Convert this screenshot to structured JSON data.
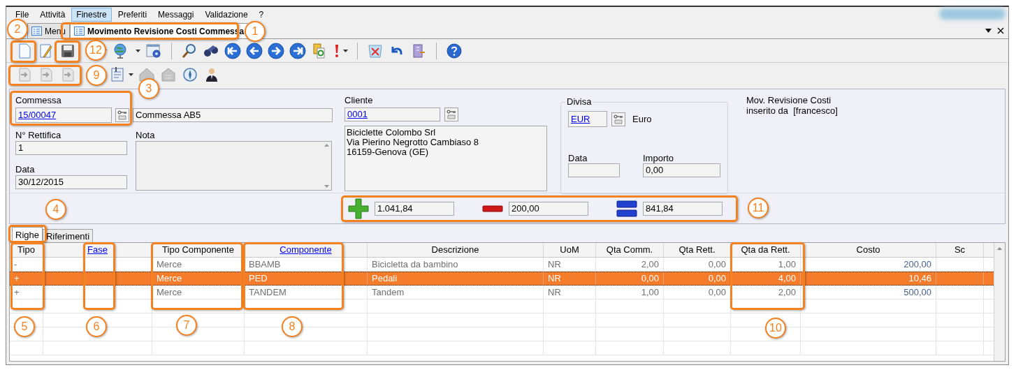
{
  "menu_bar": [
    {
      "label": "File",
      "selected": false
    },
    {
      "label": "Attività",
      "selected": false
    },
    {
      "label": "Finestre",
      "selected": true
    },
    {
      "label": "Preferiti",
      "selected": false
    },
    {
      "label": "Messaggi",
      "selected": false
    },
    {
      "label": "Validazione",
      "selected": false
    },
    {
      "label": "?",
      "selected": false
    }
  ],
  "document_tabs": [
    {
      "label": "Menu",
      "selected": false
    },
    {
      "label": "Movimento Revisione Costi Commessa",
      "selected": true
    }
  ],
  "form": {
    "commessa": {
      "label": "Commessa",
      "value": "15/00047",
      "description": "Commessa AB5"
    },
    "rettifica": {
      "label": "N° Rettifica",
      "value": "1"
    },
    "data": {
      "label": "Data",
      "value": "30/12/2015"
    },
    "nota": {
      "label": "Nota"
    },
    "cliente": {
      "label": "Cliente",
      "value": "0001",
      "address": [
        "Biciclette Colombo Srl",
        "Via Pierino Negrotto Cambiaso 8",
        "16159-Genova (GE)"
      ]
    },
    "divisa": {
      "legend": "Divisa",
      "value": "EUR",
      "description": "Euro",
      "date_label": "Data",
      "amount_label": "Importo",
      "amount": "0,00"
    },
    "info": [
      "Mov. Revisione Costi",
      "inserito da  [francesco]"
    ]
  },
  "totals": [
    {
      "kind": "plus",
      "value": "1.041,84"
    },
    {
      "kind": "minus",
      "value": "200,00"
    },
    {
      "kind": "equals",
      "value": "841,84"
    }
  ],
  "detail_tabs": [
    {
      "label": "Righe",
      "selected": true
    },
    {
      "label": "Riferimenti",
      "selected": false
    }
  ],
  "table": {
    "columns": [
      {
        "label": "Tipo",
        "link": false
      },
      {
        "label": "Fase",
        "link": true
      },
      {
        "label": "Tipo Componente",
        "link": false
      },
      {
        "label": "Componente",
        "link": true
      },
      {
        "label": "Descrizione",
        "link": false
      },
      {
        "label": "UoM",
        "link": false
      },
      {
        "label": "Qta Comm.",
        "link": false
      },
      {
        "label": "Qta Rett.",
        "link": false
      },
      {
        "label": "Qta da Rett.",
        "link": false
      },
      {
        "label": "Costo",
        "link": false
      },
      {
        "label": "Sc",
        "link": false
      }
    ],
    "rows": [
      {
        "tipo": "-",
        "tipo_componente": "Merce",
        "componente": "BBAMB",
        "descrizione": "Bicicletta da bambino",
        "uom": "NR",
        "qta_comm": "2,00",
        "qta_rett": "0,00",
        "qta_da_rett": "1,00",
        "costo": "200,00",
        "selected": false
      },
      {
        "tipo": "+",
        "tipo_componente": "Merce",
        "componente": "PED",
        "descrizione": "Pedali",
        "uom": "NR",
        "qta_comm": "0,00",
        "qta_rett": "0,00",
        "qta_da_rett": "4,00",
        "costo": "10,46",
        "selected": true
      },
      {
        "tipo": "+",
        "tipo_componente": "Merce",
        "componente": "TANDEM",
        "descrizione": "Tandem",
        "uom": "NR",
        "qta_comm": "1,00",
        "qta_rett": "0,00",
        "qta_da_rett": "2,00",
        "costo": "500,00",
        "selected": false
      }
    ]
  },
  "callouts": [
    "1",
    "2",
    "3",
    "4",
    "5",
    "6",
    "7",
    "8",
    "9",
    "10",
    "11",
    "12"
  ]
}
